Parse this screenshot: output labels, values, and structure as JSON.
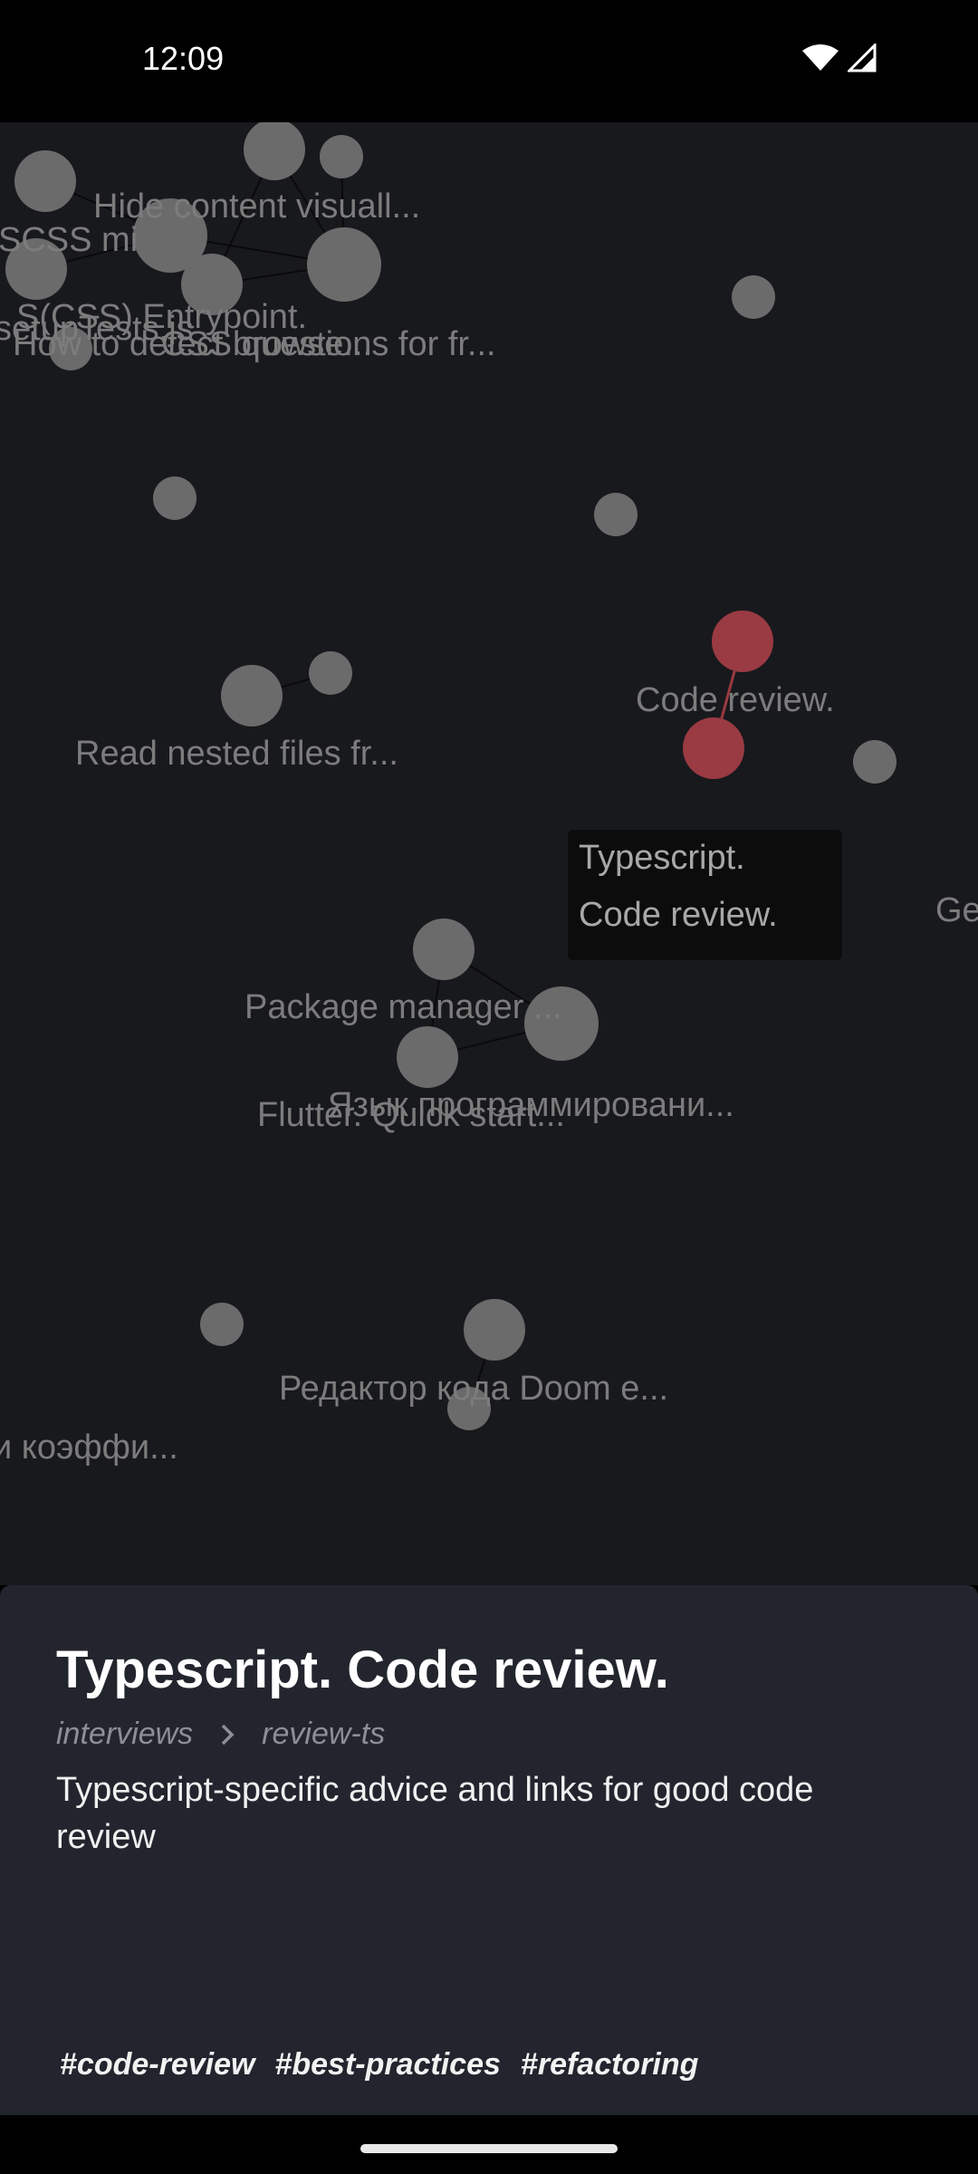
{
  "status_bar": {
    "time": "12:09"
  },
  "graph": {
    "labels": [
      "Hide content visuall...",
      "SCSS mi",
      "S(CSS) Entrypoint.",
      "How to detect browse...",
      "CSS questions for fr...",
      "setupTests.js",
      "Code review.",
      "Read nested files fr...",
      "Ge",
      "Package manager ...",
      "Язык программировани...",
      "Flutter. Quick start...",
      "Редактор кода Doom e...",
      "и коэффи..."
    ]
  },
  "tooltip": {
    "line1": "Typescript.",
    "line2": "Code review."
  },
  "note": {
    "title": "Typescript. Code review.",
    "breadcrumb": [
      "interviews",
      "review-ts"
    ],
    "description": "Typescript-specific advice and links for good code review",
    "tags": [
      "#code-review",
      "#best-practices",
      "#refactoring"
    ]
  },
  "colors": {
    "graph_bg": "#18191d",
    "node": "#6b6b6b",
    "highlight": "#9a3a42",
    "sheet_bg": "#22252d"
  }
}
